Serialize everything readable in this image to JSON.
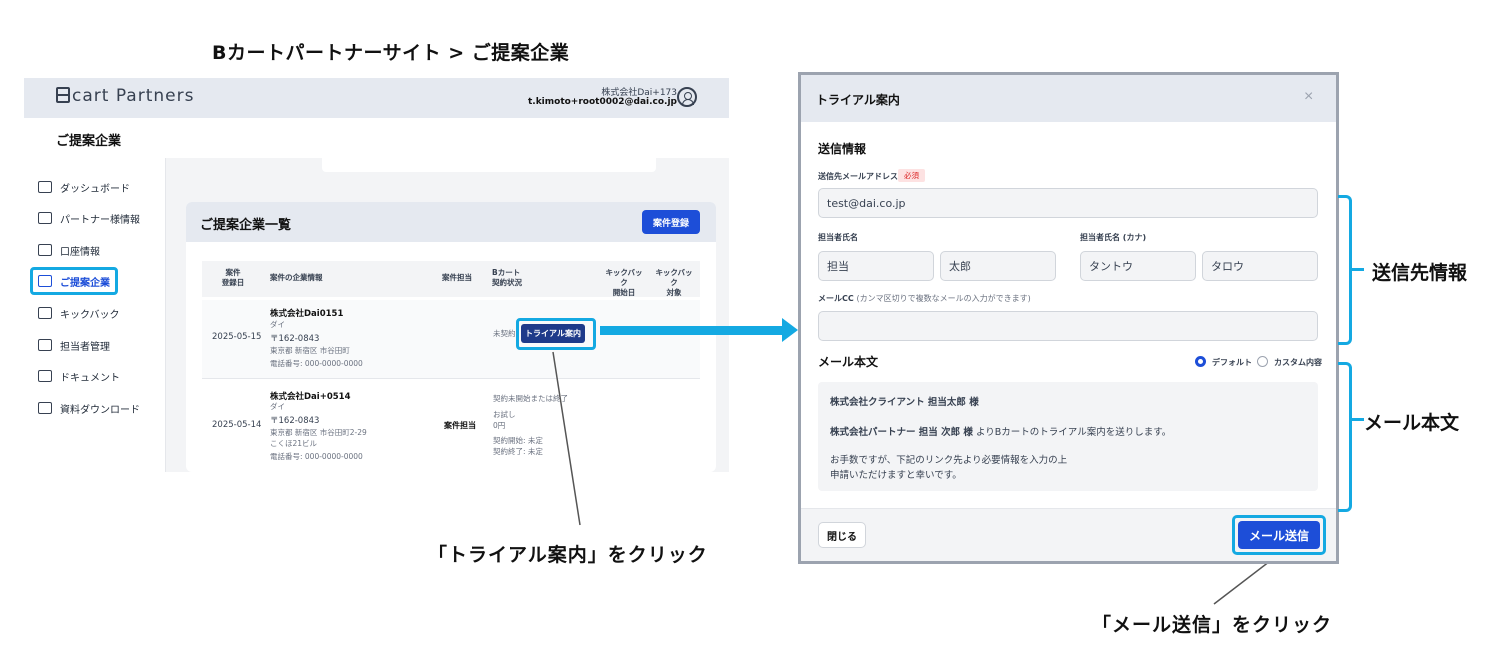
{
  "heading": "Bカートパートナーサイト > ご提案企業",
  "app": {
    "logo": "cart Partners",
    "account_company": "株式会社Dai+173",
    "account_email": "t.kimoto+root0002@dai.co.jp",
    "page_title": "ご提案企業",
    "nav": [
      {
        "label": "ダッシュボード"
      },
      {
        "label": "パートナー様情報"
      },
      {
        "label": "口座情報"
      },
      {
        "label": "ご提案企業"
      },
      {
        "label": "キックバック"
      },
      {
        "label": "担当者管理"
      },
      {
        "label": "ドキュメント"
      },
      {
        "label": "資料ダウンロード"
      }
    ],
    "card_title": "ご提案企業一覧",
    "register_button": "案件登録",
    "columns": {
      "registered_1": "案件",
      "registered_2": "登録日",
      "company": "案件の企業情報",
      "owner": "案件担当",
      "contract_1": "Bカート",
      "contract_2": "契約状況",
      "kb_start_1": "キックバック",
      "kb_start_2": "開始日",
      "kb_target_1": "キックバック",
      "kb_target_2": "対象"
    },
    "rows": [
      {
        "date": "2025-05-15",
        "company": "株式会社Dai0151",
        "kana": "ダイ",
        "zip": "〒162-0843",
        "address": "東京都 新宿区 市谷田町",
        "address2": "",
        "phone": "電話番号: 000-0000-0000",
        "owner": "",
        "status": "未契約",
        "trial_button": "トライアル案内"
      },
      {
        "date": "2025-05-14",
        "company": "株式会社Dai+0514",
        "kana": "ダイ",
        "zip": "〒162-0843",
        "address": "東京都 新宿区 市谷田町2-29",
        "address2": "こくほ21ビル",
        "phone": "電話番号: 000-0000-0000",
        "owner": "案件担当",
        "status": "契約未開始または終了",
        "plan": "お試し",
        "price": "0円",
        "start": "契約開始: 未定",
        "end": "契約終了: 未定"
      }
    ]
  },
  "callouts": {
    "trial": "「トライアル案内」をクリック",
    "send": "「メール送信」をクリック"
  },
  "modal": {
    "title": "トライアル案内",
    "close_icon": "×",
    "section_send": "送信情報",
    "email_label": "送信先メールアドレス",
    "required": "必須",
    "email_value": "test@dai.co.jp",
    "name_label": "担当者氏名",
    "name_last": "担当",
    "name_first": "太郎",
    "kana_label": "担当者氏名 (カナ)",
    "kana_last": "タントウ",
    "kana_first": "タロウ",
    "cc_label": "メールCC",
    "cc_hint": "(カンマ区切りで複数なメールの入力ができます)",
    "cc_value": "",
    "body_title": "メール本文",
    "radio_default": "デフォルト",
    "radio_custom": "カスタム内容",
    "mail_line1": "株式会社クライアント 担当太郎 様",
    "mail_line2_bold": "株式会社パートナー 担当 次郎 様",
    "mail_line2_rest": "よりBカートのトライアル案内を送りします。",
    "mail_line3": "お手数ですが、下記のリンク先より必要情報を入力の上",
    "mail_line4": "申請いただけますと幸いです。",
    "close_button": "閉じる",
    "send_button": "メール送信"
  },
  "brackets": {
    "recipient": "送信先情報",
    "body": "メール本文"
  },
  "colors": {
    "accent": "#14a9e2",
    "primary": "#1d4ed8"
  }
}
